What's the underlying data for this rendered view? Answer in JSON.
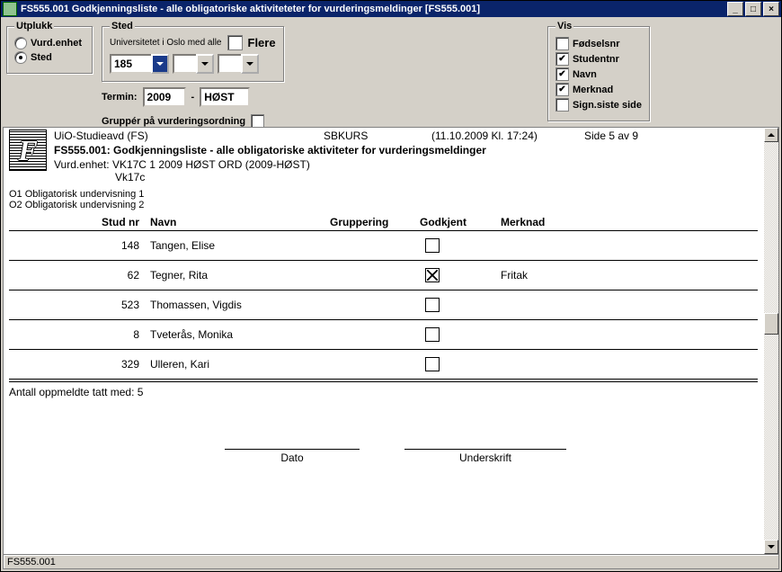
{
  "title": "FS555.001 Godkjenningsliste - alle obligatoriske aktiviteteter for vurderingsmeldinger [FS555.001]",
  "utplukk": {
    "legend": "Utplukk",
    "opt1": "Vurd.enhet",
    "opt2": "Sted"
  },
  "sted": {
    "legend": "Sted",
    "hint": "Universitetet i Oslo med alle",
    "flere": "Flere",
    "value1": "185",
    "termin_label": "Termin:",
    "termin_year": "2009",
    "termin_sem": "HØST",
    "group_label": "Gruppér på vurderingsordning"
  },
  "vis": {
    "legend": "Vis",
    "c1": "Fødselsnr",
    "c2": "Studentnr",
    "c3": "Navn",
    "c4": "Merknad",
    "c5": "Sign.siste side"
  },
  "doc": {
    "org": "UiO-Studieavd (FS)",
    "code": "SBKURS",
    "dt": "(11.10.2009 Kl. 17:24)",
    "page": "Side 5 av 9",
    "heading": "FS555.001: Godkjenningsliste - alle obligatoriske aktiviteter for vurderingsmeldinger",
    "enhet_lbl": "Vurd.enhet:",
    "enhet_val": "VK17C 1 2009 HØST ORD (2009-HØST)",
    "enhet_sub": "Vk17c",
    "o1": "O1 Obligatorisk undervisning 1",
    "o2": "O2 Obligatorisk undervisning 2",
    "h_sn": "Stud nr",
    "h_name": "Navn",
    "h_grp": "Gruppering",
    "h_god": "Godkjent",
    "h_mrk": "Merknad",
    "rows": [
      {
        "sn": "148",
        "name": "Tangen, Elise",
        "chk": false,
        "mrk": ""
      },
      {
        "sn": "62",
        "name": "Tegner, Rita",
        "chk": true,
        "mrk": "Fritak"
      },
      {
        "sn": "523",
        "name": "Thomassen, Vigdis",
        "chk": false,
        "mrk": ""
      },
      {
        "sn": "8",
        "name": "Tveterås, Monika",
        "chk": false,
        "mrk": ""
      },
      {
        "sn": "329",
        "name": "Ulleren, Kari",
        "chk": false,
        "mrk": ""
      }
    ],
    "count": "Antall oppmeldte tatt med: 5",
    "sig1": "Dato",
    "sig2": "Underskrift"
  },
  "status": "FS555.001"
}
